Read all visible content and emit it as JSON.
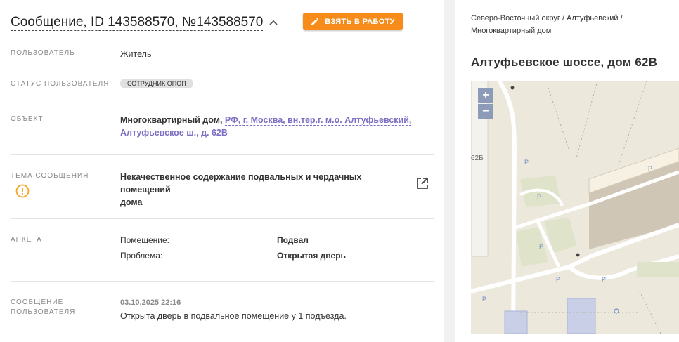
{
  "header": {
    "title": "Сообщение, ID 143588570, №143588570",
    "take_button": "ВЗЯТЬ В РАБОТУ"
  },
  "fields": {
    "user_label": "ПОЛЬЗОВАТЕЛЬ",
    "user_value": "Житель",
    "status_label": "СТАТУС ПОЛЬЗОВАТЕЛЯ",
    "status_badge": "СОТРУДНИК ОПОП",
    "object_label": "ОБЪЕКТ",
    "object_type": "Многоквартирный дом,",
    "object_link_line1": "РФ, г. Москва, вн.тер.г. м.о. Алтуфьевский,",
    "object_link_line2": "Алтуфьевское ш., д. 62В",
    "topic_label": "ТЕМА СООБЩЕНИЯ",
    "topic_line1": "Некачественное содержание подвальных и чердачных помещений",
    "topic_line2": "дома",
    "survey_label": "АНКЕТА",
    "survey": [
      {
        "key": "Помещение:",
        "value": "Подвал"
      },
      {
        "key": "Проблема:",
        "value": "Открытая дверь"
      }
    ],
    "message_label_line1": "СООБЩЕНИЕ",
    "message_label_line2": "ПОЛЬЗОВАТЕЛЯ",
    "message_date": "03.10.2025 22:16",
    "message_text": "Открыта дверь в подвальное помещение у 1 подъезда."
  },
  "side": {
    "breadcrumb_line1": "Северо-Восточный округ / Алтуфьевский /",
    "breadcrumb_line2": "Многоквартирный дом",
    "address": "Алтуфьевское шоссе, дом 62В",
    "map": {
      "zoom_in": "+",
      "zoom_out": "−",
      "building_label": "62Б",
      "parking": [
        "P",
        "P",
        "P",
        "P",
        "P",
        "P",
        "P"
      ]
    }
  },
  "colors": {
    "accent": "#f78c1b",
    "link": "#7c6fc4",
    "warning": "#f5a623"
  }
}
